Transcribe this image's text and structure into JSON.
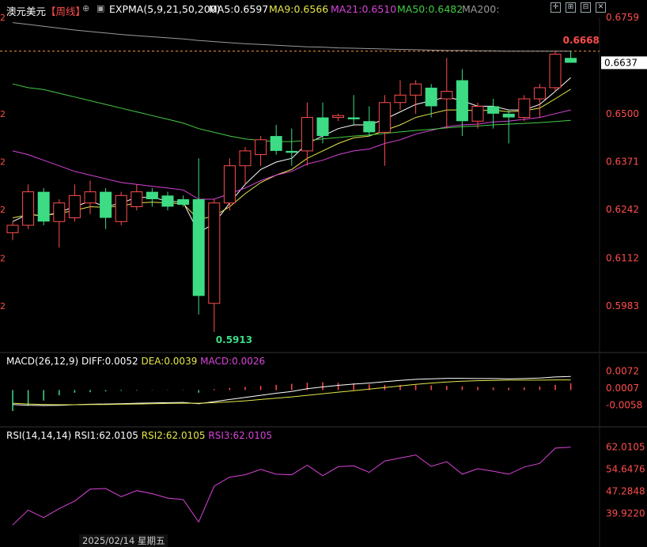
{
  "header": {
    "symbol": "澳元美元",
    "period": "【周线】",
    "indicator": "EXPMA(5,9,21,50,200)",
    "ma5": "MA5:0.6597",
    "ma9": "MA9:0.6566",
    "ma21": "MA21:0.6510",
    "ma50": "MA50:0.6482",
    "ma200": "MA200:",
    "colors": {
      "ma5": "#ffffff",
      "ma9": "#e6e64c",
      "ma21": "#d944d9",
      "ma50": "#44cc44",
      "ma200": "#9a9a9a"
    }
  },
  "macd_header": {
    "name": "MACD(26,12,9)",
    "diff": "DIFF:0.0052",
    "dea": "DEA:0.0039",
    "macd": "MACD:0.0026"
  },
  "rsi_header": {
    "name": "RSI(14,14,14)",
    "rsi1": "RSI1:62.0105",
    "rsi2": "RSI2:62.0105",
    "rsi3": "RSI3:62.0105"
  },
  "date_label": "2025/02/14 星期五",
  "colors": {
    "up": "#ff4d4d",
    "down": "#3ddc84",
    "axis_text": "#ff4d4d",
    "current_bg": "#ffffff"
  },
  "chart_data": [
    {
      "type": "candlestick",
      "title": "澳元美元【周线】",
      "ylim": [
        0.5913,
        0.6759
      ],
      "y_ticks": [
        "0.6759",
        "0.6500",
        "0.6371",
        "0.6242",
        "0.6112",
        "0.5983"
      ],
      "current_price": "0.6637",
      "dashed_level_label": "0.6668",
      "high_label": "0.6668",
      "low_label": "0.5913",
      "candles": [
        {
          "o": 0.618,
          "h": 0.621,
          "l": 0.616,
          "c": 0.62
        },
        {
          "o": 0.62,
          "h": 0.631,
          "l": 0.619,
          "c": 0.629
        },
        {
          "o": 0.629,
          "h": 0.63,
          "l": 0.62,
          "c": 0.621
        },
        {
          "o": 0.621,
          "h": 0.627,
          "l": 0.614,
          "c": 0.626
        },
        {
          "o": 0.622,
          "h": 0.631,
          "l": 0.621,
          "c": 0.628
        },
        {
          "o": 0.626,
          "h": 0.632,
          "l": 0.623,
          "c": 0.629
        },
        {
          "o": 0.629,
          "h": 0.63,
          "l": 0.619,
          "c": 0.622
        },
        {
          "o": 0.621,
          "h": 0.629,
          "l": 0.62,
          "c": 0.628
        },
        {
          "o": 0.625,
          "h": 0.631,
          "l": 0.624,
          "c": 0.629
        },
        {
          "o": 0.629,
          "h": 0.63,
          "l": 0.625,
          "c": 0.627
        },
        {
          "o": 0.628,
          "h": 0.629,
          "l": 0.624,
          "c": 0.625
        },
        {
          "o": 0.627,
          "h": 0.628,
          "l": 0.625,
          "c": 0.6255
        },
        {
          "o": 0.627,
          "h": 0.638,
          "l": 0.596,
          "c": 0.601
        },
        {
          "o": 0.599,
          "h": 0.627,
          "l": 0.5913,
          "c": 0.626
        },
        {
          "o": 0.626,
          "h": 0.638,
          "l": 0.624,
          "c": 0.636
        },
        {
          "o": 0.636,
          "h": 0.641,
          "l": 0.631,
          "c": 0.64
        },
        {
          "o": 0.639,
          "h": 0.644,
          "l": 0.636,
          "c": 0.643
        },
        {
          "o": 0.644,
          "h": 0.647,
          "l": 0.639,
          "c": 0.64
        },
        {
          "o": 0.64,
          "h": 0.646,
          "l": 0.636,
          "c": 0.6395
        },
        {
          "o": 0.64,
          "h": 0.653,
          "l": 0.636,
          "c": 0.649
        },
        {
          "o": 0.649,
          "h": 0.653,
          "l": 0.642,
          "c": 0.644
        },
        {
          "o": 0.649,
          "h": 0.65,
          "l": 0.648,
          "c": 0.6495
        },
        {
          "o": 0.649,
          "h": 0.655,
          "l": 0.647,
          "c": 0.6485
        },
        {
          "o": 0.648,
          "h": 0.652,
          "l": 0.644,
          "c": 0.645
        },
        {
          "o": 0.645,
          "h": 0.655,
          "l": 0.636,
          "c": 0.653
        },
        {
          "o": 0.653,
          "h": 0.659,
          "l": 0.651,
          "c": 0.655
        },
        {
          "o": 0.655,
          "h": 0.659,
          "l": 0.65,
          "c": 0.658
        },
        {
          "o": 0.657,
          "h": 0.658,
          "l": 0.649,
          "c": 0.652
        },
        {
          "o": 0.654,
          "h": 0.665,
          "l": 0.646,
          "c": 0.656
        },
        {
          "o": 0.659,
          "h": 0.662,
          "l": 0.644,
          "c": 0.648
        },
        {
          "o": 0.648,
          "h": 0.653,
          "l": 0.646,
          "c": 0.652
        },
        {
          "o": 0.652,
          "h": 0.654,
          "l": 0.646,
          "c": 0.65
        },
        {
          "o": 0.65,
          "h": 0.651,
          "l": 0.642,
          "c": 0.649
        },
        {
          "o": 0.649,
          "h": 0.655,
          "l": 0.648,
          "c": 0.654
        },
        {
          "o": 0.654,
          "h": 0.658,
          "l": 0.649,
          "c": 0.657
        },
        {
          "o": 0.657,
          "h": 0.667,
          "l": 0.656,
          "c": 0.666
        },
        {
          "o": 0.665,
          "h": 0.6668,
          "l": 0.664,
          "c": 0.6637
        }
      ],
      "series": [
        {
          "name": "MA5",
          "values": [
            0.621,
            0.623,
            0.6225,
            0.6235,
            0.625,
            0.6265,
            0.625,
            0.626,
            0.6275,
            0.6275,
            0.6265,
            0.6262,
            0.618,
            0.6205,
            0.626,
            0.631,
            0.635,
            0.637,
            0.638,
            0.642,
            0.644,
            0.646,
            0.647,
            0.647,
            0.6485,
            0.6505,
            0.6525,
            0.6535,
            0.6545,
            0.6535,
            0.652,
            0.652,
            0.651,
            0.651,
            0.6525,
            0.656,
            0.6597
          ]
        },
        {
          "name": "MA9",
          "values": [
            0.622,
            0.6228,
            0.6226,
            0.6232,
            0.624,
            0.625,
            0.6248,
            0.6252,
            0.626,
            0.6262,
            0.626,
            0.6258,
            0.6215,
            0.6225,
            0.625,
            0.6285,
            0.6315,
            0.6335,
            0.635,
            0.638,
            0.64,
            0.642,
            0.6435,
            0.644,
            0.6455,
            0.647,
            0.649,
            0.65,
            0.651,
            0.651,
            0.6508,
            0.651,
            0.6505,
            0.6508,
            0.6515,
            0.654,
            0.6566
          ]
        },
        {
          "name": "MA21",
          "values": [
            0.64,
            0.639,
            0.6375,
            0.636,
            0.6345,
            0.6335,
            0.6325,
            0.6315,
            0.631,
            0.6305,
            0.63,
            0.6295,
            0.627,
            0.627,
            0.6285,
            0.63,
            0.632,
            0.6335,
            0.6345,
            0.6365,
            0.6375,
            0.639,
            0.64,
            0.6405,
            0.642,
            0.643,
            0.6445,
            0.6455,
            0.6465,
            0.647,
            0.6472,
            0.6478,
            0.648,
            0.6485,
            0.649,
            0.65,
            0.651
          ]
        },
        {
          "name": "MA50",
          "values": [
            0.658,
            0.657,
            0.6565,
            0.6555,
            0.6545,
            0.6535,
            0.6525,
            0.6515,
            0.6505,
            0.6495,
            0.6485,
            0.6475,
            0.646,
            0.645,
            0.644,
            0.6432,
            0.6428,
            0.6425,
            0.6425,
            0.6428,
            0.6432,
            0.6436,
            0.644,
            0.6443,
            0.6447,
            0.6451,
            0.6455,
            0.6458,
            0.6462,
            0.6465,
            0.6467,
            0.647,
            0.6472,
            0.6474,
            0.6476,
            0.6479,
            0.6482
          ]
        },
        {
          "name": "MA200",
          "values": [
            0.6745,
            0.674,
            0.6735,
            0.673,
            0.6725,
            0.6721,
            0.6717,
            0.6713,
            0.671,
            0.6707,
            0.6704,
            0.6701,
            0.6697,
            0.6694,
            0.6691,
            0.6688,
            0.6686,
            0.6684,
            0.6682,
            0.668,
            0.6679,
            0.6677,
            0.6676,
            0.6675,
            0.6674,
            0.6673,
            0.6672,
            0.6671,
            0.667,
            0.667,
            0.6669,
            0.6669,
            0.6668,
            0.6668,
            0.6668,
            0.6668,
            0.6668
          ]
        }
      ]
    },
    {
      "type": "bar",
      "title": "MACD(26,12,9)",
      "ylim": [
        -0.008,
        0.008
      ],
      "y_ticks": [
        "0.0072",
        "0.0007",
        "-0.0058"
      ],
      "hist": [
        -0.008,
        -0.006,
        -0.004,
        -0.002,
        -0.001,
        -0.0008,
        -0.0005,
        -0.0003,
        -0.0002,
        -0.0001,
        -0.0001,
        -0.0001,
        -0.001,
        0.0004,
        0.0008,
        0.0012,
        0.0016,
        0.002,
        0.0024,
        0.0028,
        0.003,
        0.0028,
        0.0026,
        0.0022,
        0.002,
        0.002,
        0.0019,
        0.0018,
        0.0016,
        0.0014,
        0.0012,
        0.001,
        0.0009,
        0.001,
        0.0014,
        0.002,
        0.0026
      ],
      "series": [
        {
          "name": "DIFF",
          "values": [
            -0.0055,
            -0.0058,
            -0.0059,
            -0.0058,
            -0.0056,
            -0.0054,
            -0.0053,
            -0.0052,
            -0.005,
            -0.0049,
            -0.0048,
            -0.0047,
            -0.0052,
            -0.0044,
            -0.0036,
            -0.0028,
            -0.002,
            -0.0012,
            -0.0005,
            0.0005,
            0.0012,
            0.0018,
            0.0023,
            0.0027,
            0.0032,
            0.0037,
            0.0041,
            0.0043,
            0.0045,
            0.0045,
            0.0044,
            0.0044,
            0.0043,
            0.0044,
            0.0046,
            0.005,
            0.0052
          ]
        },
        {
          "name": "DEA",
          "values": [
            -0.005,
            -0.0053,
            -0.0055,
            -0.0056,
            -0.0056,
            -0.0055,
            -0.0055,
            -0.0054,
            -0.0053,
            -0.0052,
            -0.0051,
            -0.005,
            -0.005,
            -0.0048,
            -0.0045,
            -0.0041,
            -0.0036,
            -0.0031,
            -0.0026,
            -0.002,
            -0.0014,
            -0.0008,
            -0.0002,
            0.0004,
            0.001,
            0.0016,
            0.0022,
            0.0027,
            0.0031,
            0.0034,
            0.0036,
            0.0037,
            0.0038,
            0.0038,
            0.0038,
            0.0039,
            0.0039
          ]
        }
      ]
    },
    {
      "type": "line",
      "title": "RSI(14,14,14)",
      "ylim": [
        35.0,
        63.0
      ],
      "y_ticks": [
        "62.0105",
        "54.6476",
        "47.2848",
        "39.9220"
      ],
      "series": [
        {
          "name": "RSI",
          "values": [
            36.0,
            41.0,
            38.5,
            41.5,
            44.0,
            48.0,
            48.2,
            45.5,
            47.5,
            46.5,
            45.0,
            44.5,
            37.0,
            49.0,
            52.0,
            52.8,
            54.6,
            53.0,
            52.8,
            56.0,
            52.5,
            55.5,
            55.8,
            53.6,
            57.4,
            58.4,
            59.4,
            55.6,
            57.2,
            53.0,
            54.8,
            54.0,
            53.0,
            55.4,
            56.6,
            61.7,
            62.0105
          ]
        }
      ]
    }
  ]
}
